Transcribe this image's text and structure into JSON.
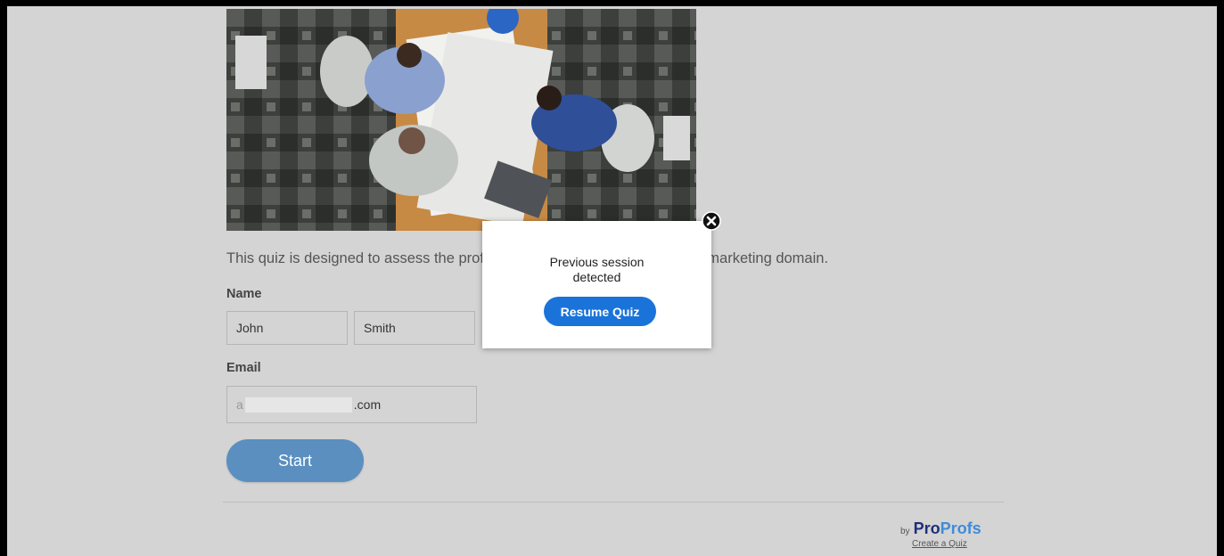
{
  "quiz": {
    "description": "This quiz is designed to assess the proficiency of candidates in the digital marketing domain.",
    "name_label": "Name",
    "first_name_value": "John",
    "last_name_value": "Smith",
    "email_label": "Email",
    "email_prefix": "a",
    "email_suffix": ".com",
    "start_label": "Start"
  },
  "footer": {
    "by": "by",
    "brand_pro": "Pro",
    "brand_profs": "Profs",
    "create_link": "Create a Quiz"
  },
  "modal": {
    "line1": "Previous session",
    "line2": "detected",
    "resume_label": "Resume Quiz",
    "close_icon": "close-icon"
  },
  "colors": {
    "start_button": "#5a8fc0",
    "resume_button": "#1a73d9",
    "brand_dark": "#1e2f7a",
    "brand_light": "#3f8cd9"
  }
}
